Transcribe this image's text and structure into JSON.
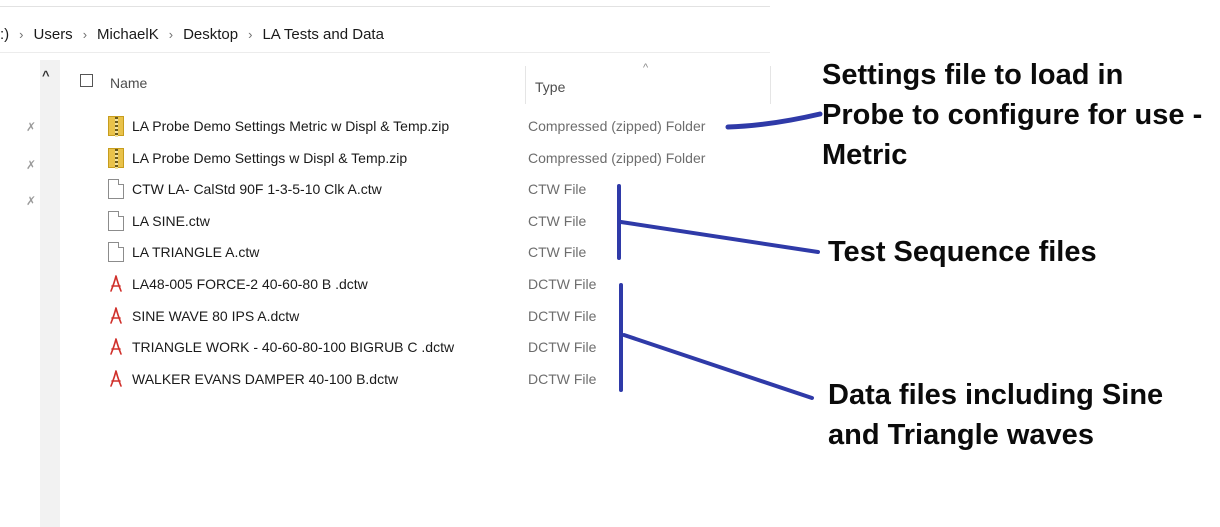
{
  "breadcrumb": {
    "items": [
      "Users",
      "MichaelK",
      "Desktop",
      "LA Tests and Data"
    ],
    "lead_fragment": ":)",
    "separator": "›"
  },
  "columns": {
    "name": "Name",
    "type": "Type"
  },
  "files": [
    {
      "name": "LA Probe Demo Settings Metric w Displ & Temp.zip",
      "type": "Compressed (zipped) Folder",
      "icon": "zip-folder-icon"
    },
    {
      "name": "LA Probe Demo Settings w Displ & Temp.zip",
      "type": "Compressed (zipped) Folder",
      "icon": "zip-folder-icon"
    },
    {
      "name": "CTW LA- CalStd 90F 1-3-5-10 Clk A.ctw",
      "type": "CTW File",
      "icon": "document-icon"
    },
    {
      "name": "LA SINE.ctw",
      "type": "CTW File",
      "icon": "document-icon"
    },
    {
      "name": "LA TRIANGLE A.ctw",
      "type": "CTW File",
      "icon": "document-icon"
    },
    {
      "name": "LA48-005 FORCE-2 40-60-80 B .dctw",
      "type": "DCTW File",
      "icon": "pdf-icon"
    },
    {
      "name": "SINE WAVE 80 IPS A.dctw",
      "type": "DCTW File",
      "icon": "pdf-icon"
    },
    {
      "name": "TRIANGLE WORK - 40-60-80-100 BIGRUB C .dctw",
      "type": "DCTW File",
      "icon": "pdf-icon"
    },
    {
      "name": "WALKER EVANS DAMPER 40-100 B.dctw",
      "type": "DCTW File",
      "icon": "pdf-icon"
    }
  ],
  "annotations": {
    "settings": [
      "Settings file to load in",
      "Probe to configure for use -",
      "Metric"
    ],
    "test_sequence": [
      "Test Sequence files"
    ],
    "data_files": [
      "Data files including Sine",
      "and Triangle waves"
    ]
  },
  "colors": {
    "annotation_line": "#2f3aa8",
    "pdf_red": "#d0302b",
    "zip_yellow": "#e9c24a"
  }
}
